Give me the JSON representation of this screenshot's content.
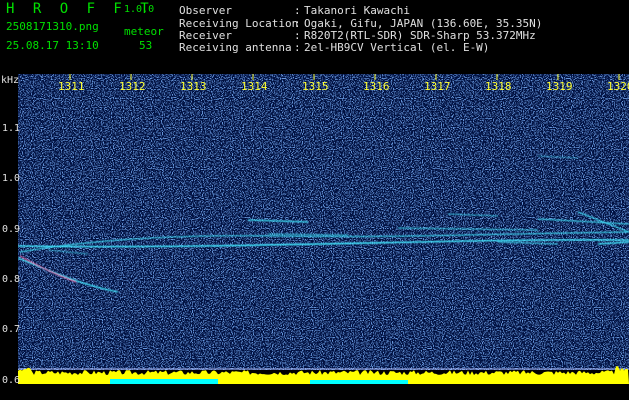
{
  "header": {
    "app_title": "H R O F F T",
    "app_version": "1.0.0",
    "file_name": "2508171310.png",
    "date_time": "25.08.17 13:10",
    "meteor_label": "meteor",
    "meteor_count": "53",
    "observer_label": "Observer",
    "observer_value": "Takanori Kawachi",
    "location_label": "Receiving Location",
    "location_value": "Ogaki, Gifu, JAPAN (136.60E, 35.35N)",
    "receiver_label": "Receiver",
    "receiver_value": "R820T2(RTL-SDR) SDR-Sharp 53.372MHz",
    "antenna_label": "Receiving antenna",
    "antenna_value": "2el-HB9CV Vertical (el. E-W)",
    "colon": ":"
  },
  "spectrogram": {
    "unit": "kHz",
    "time_ticks": [
      "1311",
      "1312",
      "1313",
      "1314",
      "1315",
      "1316",
      "1317",
      "1318",
      "1319",
      "1320"
    ],
    "freq_ticks": [
      "1.1",
      "1.0",
      "0.9",
      "0.8",
      "0.7",
      "0.6"
    ],
    "colors": {
      "background": "#001040",
      "noise": "#2a5cd0",
      "trace": "#40e8ff",
      "tick_label": "#ffff33",
      "level_bar": "#ffff00",
      "level_bar_accent": "#00ffff"
    }
  }
}
